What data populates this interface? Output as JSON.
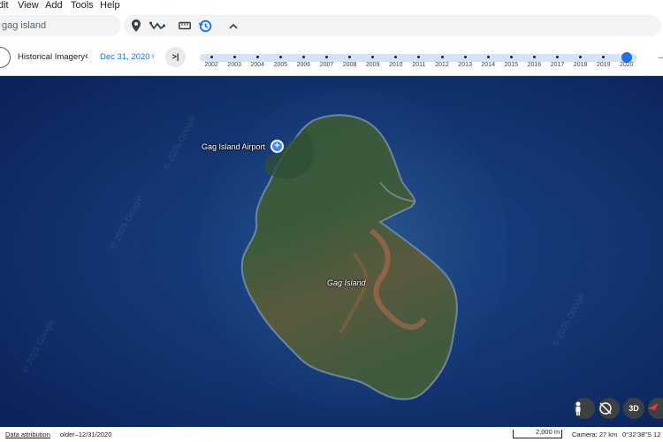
{
  "menu": {
    "items": [
      "dit",
      "View",
      "Add",
      "Tools",
      "Help"
    ]
  },
  "search": {
    "value": "gag island"
  },
  "history": {
    "label": "Historical Imagery",
    "date": "Dec 31, 2020",
    "selected_year": "2020",
    "years": [
      "2002",
      "2003",
      "2004",
      "2005",
      "2006",
      "2007",
      "2008",
      "2009",
      "2010",
      "2011",
      "2012",
      "2013",
      "2014",
      "2015",
      "2016",
      "2017",
      "2018",
      "2019",
      "2020"
    ]
  },
  "map": {
    "airport_label": "Gag Island Airport",
    "island_label": "Gag Island",
    "watermark": "© 2025 Google",
    "btn_3d": "3D"
  },
  "status": {
    "attribution": "Data attribution",
    "imagery_date": "older–12/31/2020",
    "scale": "2,000 m",
    "camera": "Camera: 27 km",
    "coords": "0°32'38\"S 12"
  },
  "colors": {
    "accent": "#1a73e8",
    "ocean": "#0c2c63",
    "land": "#3a5a3a"
  }
}
